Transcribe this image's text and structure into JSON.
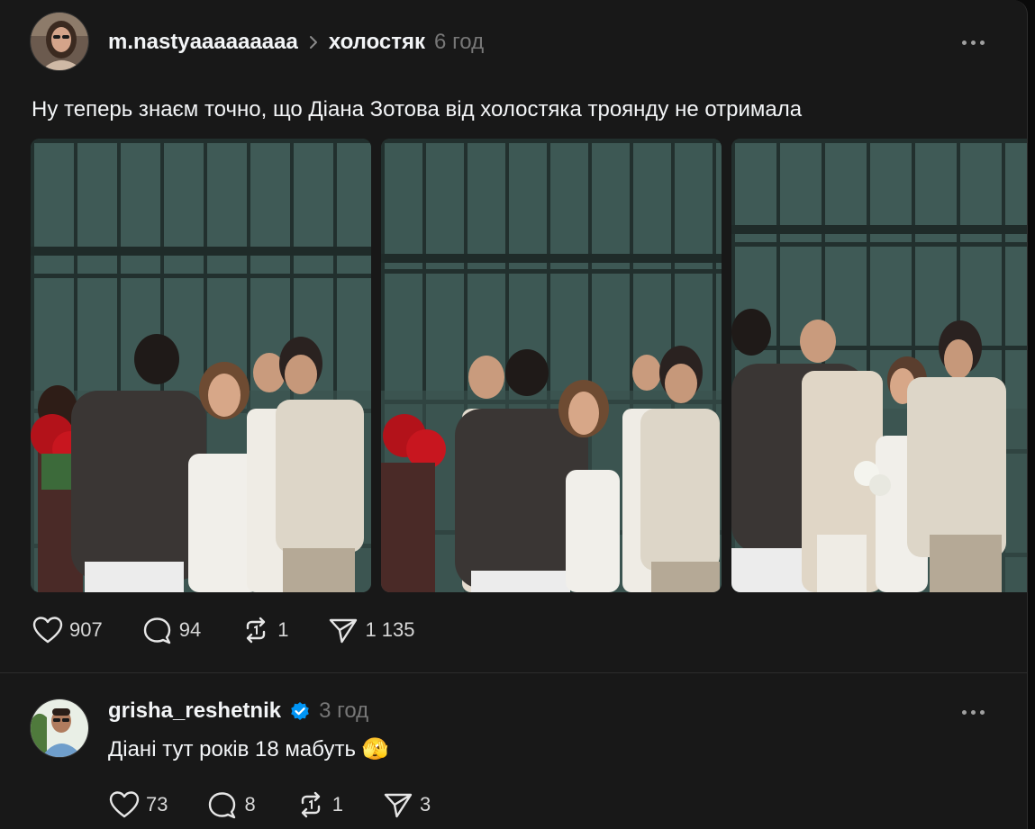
{
  "post": {
    "username": "m.nastyaaaaaaaaa",
    "separator_icon": "chevron-right-icon",
    "topic": "холостяк",
    "time": "6 год",
    "text": "Ну теперь знаєм точно, що Діана Зотова від холостяка троянду не отримала",
    "photos_count": 3,
    "stats": {
      "likes": "907",
      "comments": "94",
      "reposts": "1",
      "shares": "1 135"
    }
  },
  "reply": {
    "username": "grisha_reshetnik",
    "verified": true,
    "time": "3 год",
    "text": "Діані тут років 18 мабуть 🫣",
    "stats": {
      "likes": "73",
      "comments": "8",
      "reposts": "1",
      "shares": "3"
    }
  },
  "colors": {
    "background": "#181818",
    "page": "#0a0a0a",
    "text": "#f3f5f7",
    "muted": "#777777",
    "verified": "#0095f6"
  }
}
